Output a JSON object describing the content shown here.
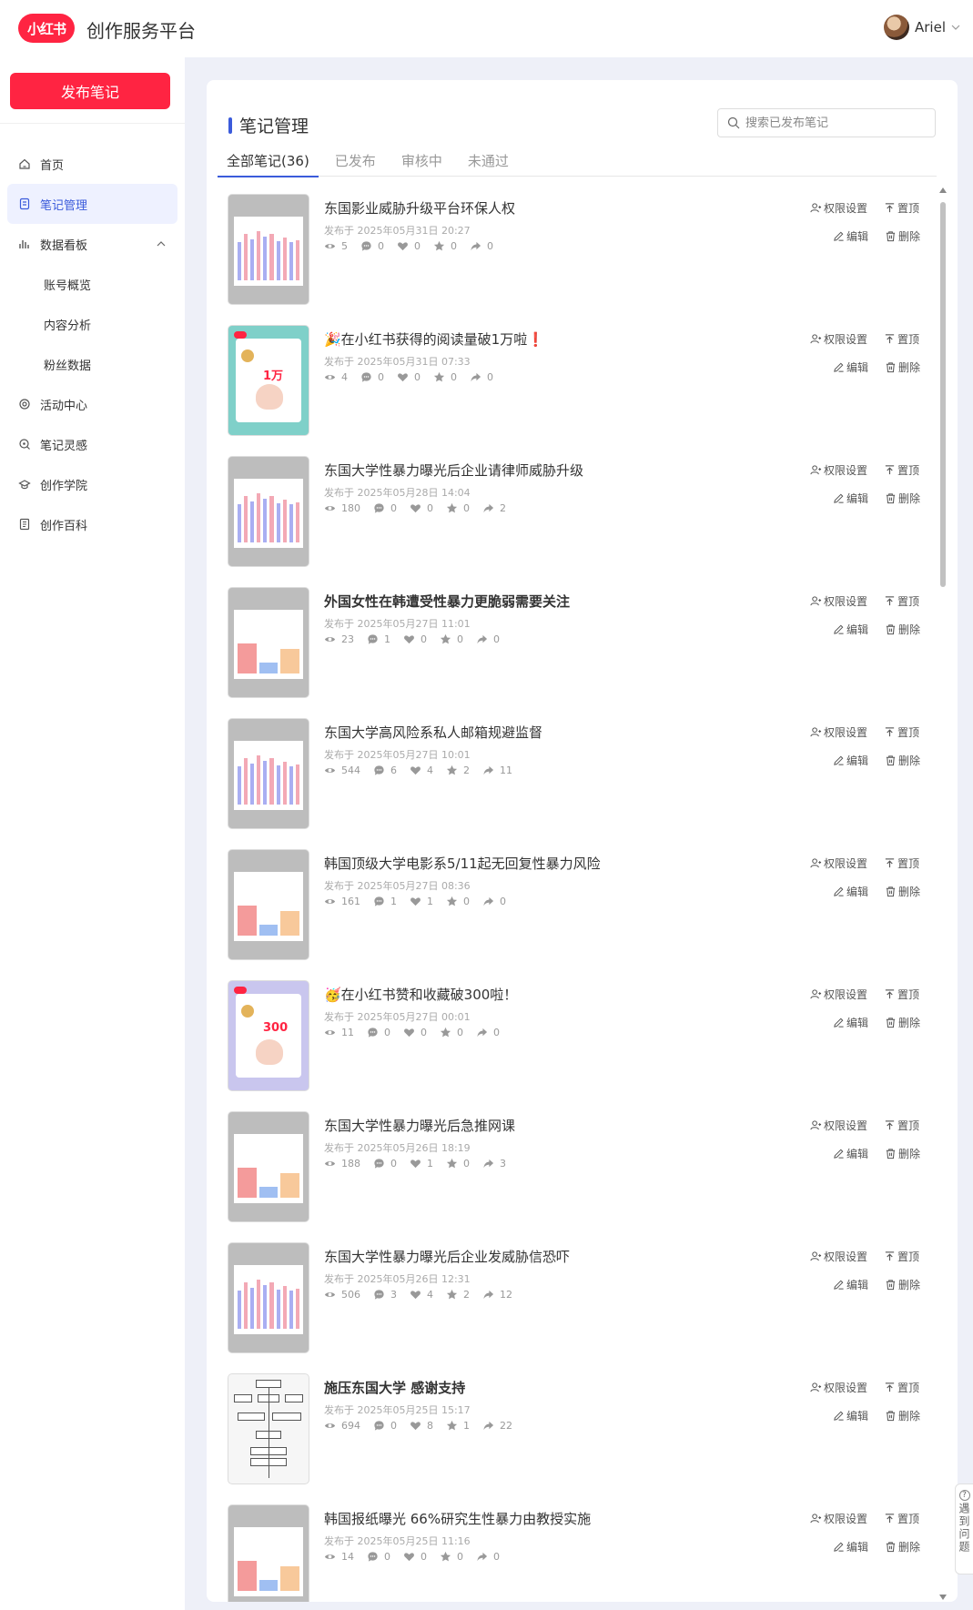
{
  "header": {
    "logo_text": "小红书",
    "app_title": "创作服务平台",
    "user_name": "Ariel"
  },
  "sidebar": {
    "publish_label": "发布笔记",
    "items": [
      {
        "label": "首页",
        "icon": "home-icon",
        "active": false,
        "sub": false
      },
      {
        "label": "笔记管理",
        "icon": "note-icon",
        "active": true,
        "sub": false
      },
      {
        "label": "数据看板",
        "icon": "bar-chart-icon",
        "active": false,
        "sub": false,
        "expanded": true
      },
      {
        "label": "账号概览",
        "sub": true
      },
      {
        "label": "内容分析",
        "sub": true
      },
      {
        "label": "粉丝数据",
        "sub": true
      },
      {
        "label": "活动中心",
        "icon": "activity-icon",
        "active": false,
        "sub": false
      },
      {
        "label": "笔记灵感",
        "icon": "inspiration-icon",
        "active": false,
        "sub": false
      },
      {
        "label": "创作学院",
        "icon": "academy-icon",
        "active": false,
        "sub": false
      },
      {
        "label": "创作百科",
        "icon": "encyclopedia-icon",
        "active": false,
        "sub": false
      }
    ]
  },
  "main": {
    "page_title": "笔记管理",
    "search_placeholder": "搜索已发布笔记",
    "tabs": [
      "全部笔记(36)",
      "已发布",
      "审核中",
      "未通过"
    ],
    "active_tab": 0,
    "actions": {
      "permission": "权限设置",
      "pin": "置顶",
      "edit": "编辑",
      "delete": "删除"
    },
    "notes": [
      {
        "title": "东国影业威胁升级平台环保人权",
        "date": "发布于 2025年05月31日 20:27",
        "views": "5",
        "comments": "0",
        "likes": "0",
        "collects": "0",
        "shares": "0",
        "thumb": "bars"
      },
      {
        "title": "🎉在小红书获得的阅读量破1万啦❗",
        "date": "发布于 2025年05月31日 07:33",
        "views": "4",
        "comments": "0",
        "likes": "0",
        "collects": "0",
        "shares": "0",
        "thumb": "celebrate",
        "thumb_text": "1万"
      },
      {
        "title": "东国大学性暴力曝光后企业请律师威胁升级",
        "date": "发布于 2025年05月28日 14:04",
        "views": "180",
        "comments": "0",
        "likes": "0",
        "collects": "0",
        "shares": "2",
        "thumb": "bars"
      },
      {
        "title": "外国女性在韩遭受性暴力更脆弱需要关注",
        "date": "发布于 2025年05月27日 11:01",
        "views": "23",
        "comments": "1",
        "likes": "0",
        "collects": "0",
        "shares": "0",
        "thumb": "bars3",
        "bold": true
      },
      {
        "title": "东国大学高风险系私人邮箱规避监督",
        "date": "发布于 2025年05月27日 10:01",
        "views": "544",
        "comments": "6",
        "likes": "4",
        "collects": "2",
        "shares": "11",
        "thumb": "bars"
      },
      {
        "title": "韩国顶级大学电影系5/11起无回复性暴力风险",
        "date": "发布于 2025年05月27日 08:36",
        "views": "161",
        "comments": "1",
        "likes": "1",
        "collects": "0",
        "shares": "0",
        "thumb": "bars3"
      },
      {
        "title": "🥳在小红书赞和收藏破300啦！",
        "date": "发布于 2025年05月27日 00:01",
        "views": "11",
        "comments": "0",
        "likes": "0",
        "collects": "0",
        "shares": "0",
        "thumb": "celebrate2",
        "thumb_text": "300"
      },
      {
        "title": "东国大学性暴力曝光后急推网课",
        "date": "发布于 2025年05月26日 18:19",
        "views": "188",
        "comments": "0",
        "likes": "1",
        "collects": "0",
        "shares": "3",
        "thumb": "bars3"
      },
      {
        "title": "东国大学性暴力曝光后企业发威胁信恐吓",
        "date": "发布于 2025年05月26日 12:31",
        "views": "506",
        "comments": "3",
        "likes": "4",
        "collects": "2",
        "shares": "12",
        "thumb": "bars"
      },
      {
        "title": "施压东国大学 感谢支持",
        "date": "发布于 2025年05月25日 15:17",
        "views": "694",
        "comments": "0",
        "likes": "8",
        "collects": "1",
        "shares": "22",
        "thumb": "flow",
        "bold": true
      },
      {
        "title": "韩国报纸曝光 66%研究生性暴力由教授实施",
        "date": "发布于 2025年05月25日 11:16",
        "views": "14",
        "comments": "0",
        "likes": "0",
        "collects": "0",
        "shares": "0",
        "thumb": "bars3"
      }
    ]
  },
  "help": {
    "label": "遇到问题"
  },
  "colors": {
    "brand": "#ff2442",
    "accent": "#3b5bdb"
  }
}
